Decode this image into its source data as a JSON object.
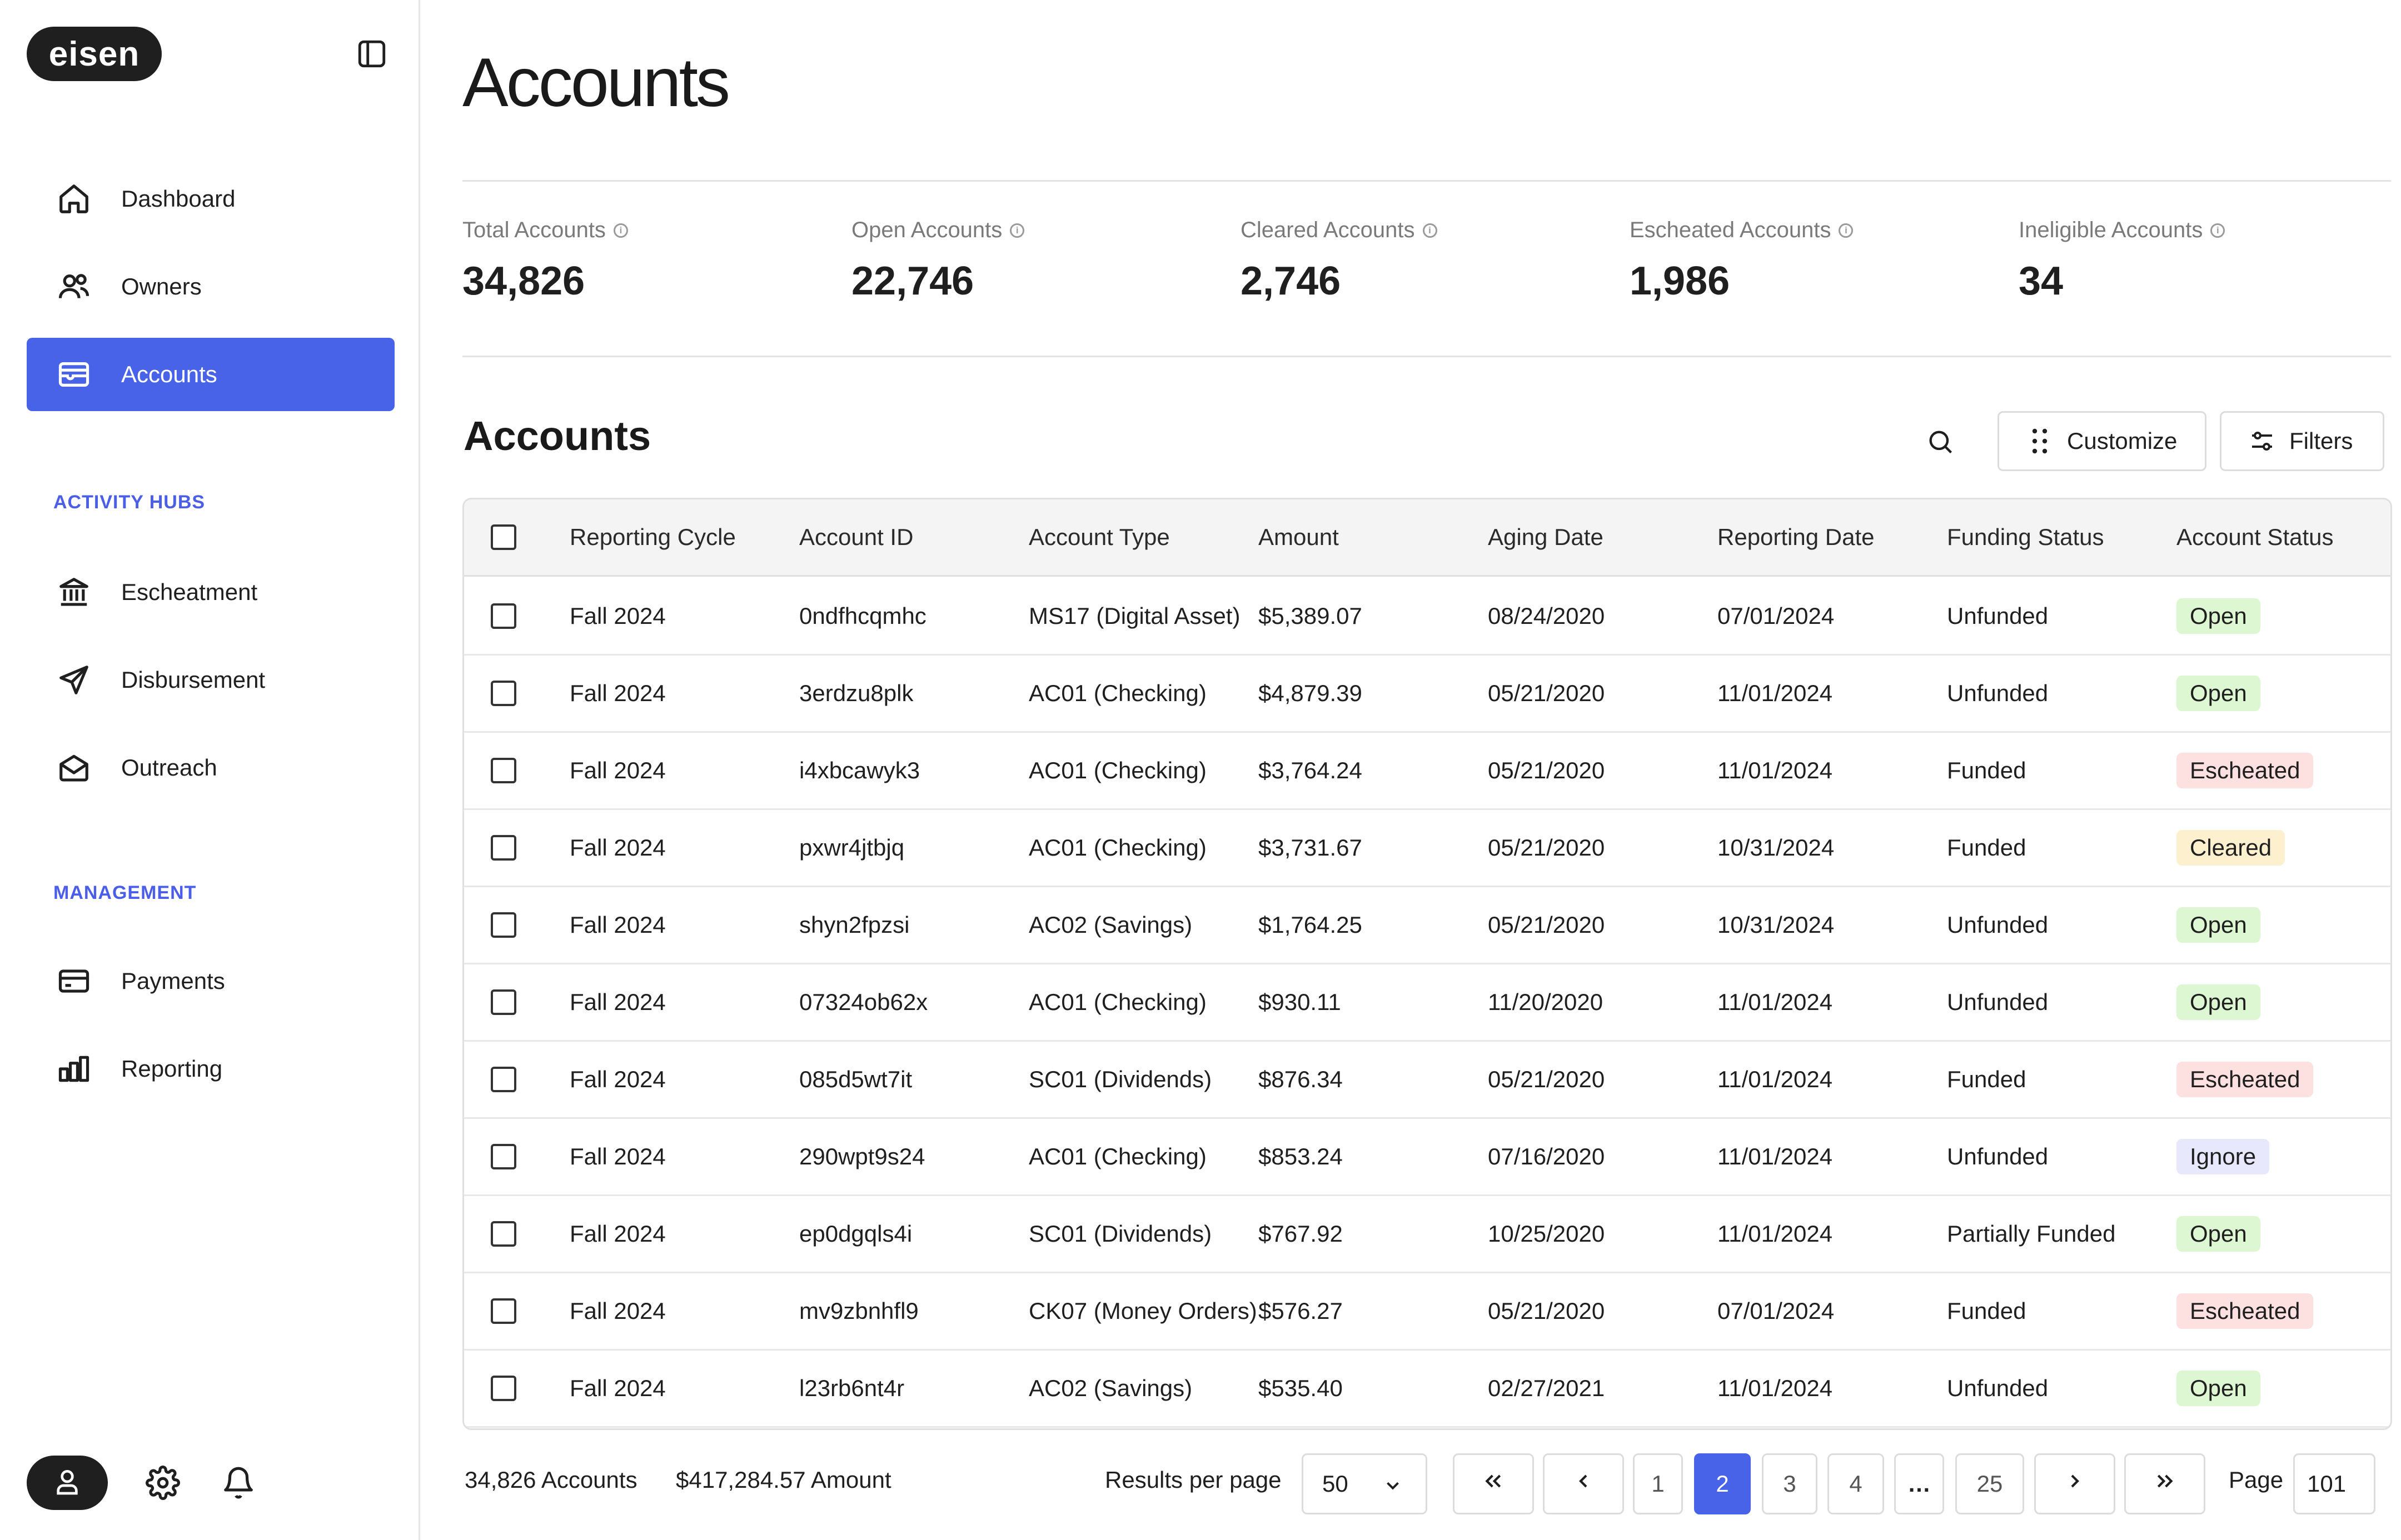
{
  "app": {
    "logo_text": "eisen"
  },
  "sidebar": {
    "nav": [
      {
        "label": "Dashboard",
        "icon": "home-icon"
      },
      {
        "label": "Owners",
        "icon": "users-icon"
      },
      {
        "label": "Accounts",
        "icon": "wallet-icon",
        "active": true
      }
    ],
    "activity_hubs_label": "ACTIVITY HUBS",
    "activity_hubs": [
      {
        "label": "Escheatment",
        "icon": "bank-icon"
      },
      {
        "label": "Disbursement",
        "icon": "send-icon"
      },
      {
        "label": "Outreach",
        "icon": "mail-open-icon"
      }
    ],
    "management_label": "MANAGEMENT",
    "management": [
      {
        "label": "Payments",
        "icon": "credit-card-icon"
      },
      {
        "label": "Reporting",
        "icon": "bar-chart-icon"
      }
    ]
  },
  "header": {
    "title": "Accounts"
  },
  "stats": [
    {
      "label": "Total Accounts",
      "value": "34,826"
    },
    {
      "label": "Open Accounts",
      "value": "22,746"
    },
    {
      "label": "Cleared Accounts",
      "value": "2,746"
    },
    {
      "label": "Escheated Accounts",
      "value": "1,986"
    },
    {
      "label": "Ineligible Accounts",
      "value": "34"
    }
  ],
  "table_section": {
    "title": "Accounts",
    "customize_label": "Customize",
    "filters_label": "Filters"
  },
  "table": {
    "columns": [
      "Reporting Cycle",
      "Account ID",
      "Account Type",
      "Amount",
      "Aging Date",
      "Reporting Date",
      "Funding Status",
      "Account Status"
    ],
    "rows": [
      [
        "Fall 2024",
        "0ndfhcqmhc",
        "MS17 (Digital Asset)",
        "$5,389.07",
        "08/24/2020",
        "07/01/2024",
        "Unfunded",
        "Open"
      ],
      [
        "Fall 2024",
        "3erdzu8plk",
        "AC01 (Checking)",
        "$4,879.39",
        "05/21/2020",
        "11/01/2024",
        "Unfunded",
        "Open"
      ],
      [
        "Fall 2024",
        "i4xbcawyk3",
        "AC01 (Checking)",
        "$3,764.24",
        "05/21/2020",
        "11/01/2024",
        "Funded",
        "Escheated"
      ],
      [
        "Fall 2024",
        "pxwr4jtbjq",
        "AC01 (Checking)",
        "$3,731.67",
        "05/21/2020",
        "10/31/2024",
        "Funded",
        "Cleared"
      ],
      [
        "Fall 2024",
        "shyn2fpzsi",
        "AC02 (Savings)",
        "$1,764.25",
        "05/21/2020",
        "10/31/2024",
        "Unfunded",
        "Open"
      ],
      [
        "Fall 2024",
        "07324ob62x",
        "AC01 (Checking)",
        "$930.11",
        "11/20/2020",
        "11/01/2024",
        "Unfunded",
        "Open"
      ],
      [
        "Fall 2024",
        "085d5wt7it",
        "SC01 (Dividends)",
        "$876.34",
        "05/21/2020",
        "11/01/2024",
        "Funded",
        "Escheated"
      ],
      [
        "Fall 2024",
        "290wpt9s24",
        "AC01 (Checking)",
        "$853.24",
        "07/16/2020",
        "11/01/2024",
        "Unfunded",
        "Ignore"
      ],
      [
        "Fall 2024",
        "ep0dgqls4i",
        "SC01 (Dividends)",
        "$767.92",
        "10/25/2020",
        "11/01/2024",
        "Partially Funded",
        "Open"
      ],
      [
        "Fall 2024",
        "mv9zbnhfl9",
        "CK07 (Money Orders)",
        "$576.27",
        "05/21/2020",
        "07/01/2024",
        "Funded",
        "Escheated"
      ],
      [
        "Fall 2024",
        "l23rb6nt4r",
        "AC02 (Savings)",
        "$535.40",
        "02/27/2021",
        "11/01/2024",
        "Unfunded",
        "Open"
      ]
    ]
  },
  "footer": {
    "accounts_count": "34,826 Accounts",
    "amount_total": "$417,284.57 Amount",
    "results_per_page_label": "Results per page",
    "results_per_page": "50",
    "pages": [
      "1",
      "2",
      "3",
      "4",
      "25"
    ],
    "current_page": "2",
    "ellipsis": "…",
    "page_label": "Page",
    "page_input_value": "101"
  },
  "colors": {
    "accent": "#4862e8",
    "badge_open": "#dcf7d1",
    "badge_escheated": "#fde0e0",
    "badge_cleared": "#fdf0cf",
    "badge_ignore": "#e7e8fb"
  }
}
